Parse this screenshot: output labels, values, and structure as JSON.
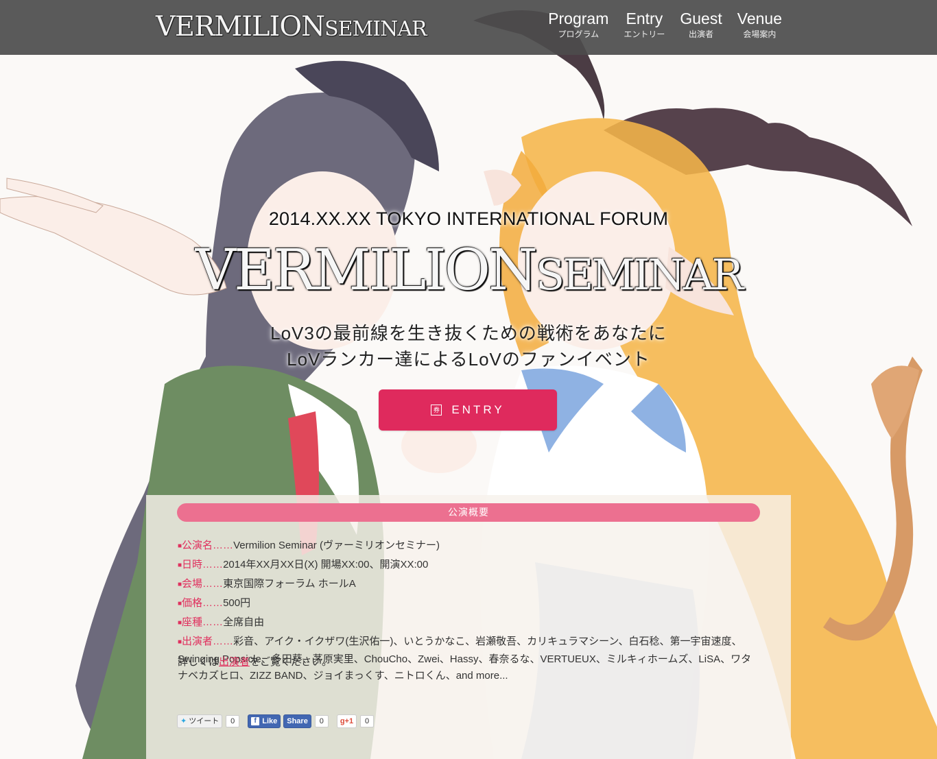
{
  "header": {
    "logo_main": "VERMILION",
    "logo_sub": "SEMINAR",
    "nav": [
      {
        "label": "Program",
        "sub": "プログラム"
      },
      {
        "label": "Entry",
        "sub": "エントリー"
      },
      {
        "label": "Guest",
        "sub": "出演者"
      },
      {
        "label": "Venue",
        "sub": "会場案内"
      }
    ]
  },
  "hero": {
    "date_line": "2014.XX.XX TOKYO INTERNATIONAL FORUM",
    "logo_main": "VERMILION",
    "logo_sub": "SEMINAR",
    "tagline1": "LoV3の最前線を生き抜くための戦術をあなたに",
    "tagline2": "LoVランカー達によるLoVのファンイベント",
    "entry_label": "ENTRY",
    "entry_icon": "ticket-icon"
  },
  "panel": {
    "heading": "公演概要",
    "rows": [
      {
        "key": "公演名……",
        "value": "Vermilion Seminar (ヴァーミリオンセミナー)"
      },
      {
        "key": "日時……",
        "value": "2014年XX月XX日(X) 開場XX:00、開演XX:00"
      },
      {
        "key": "会場……",
        "value": "東京国際フォーラム ホールA"
      },
      {
        "key": "価格……",
        "value": "500円"
      },
      {
        "key": "座種……",
        "value": "全席自由"
      }
    ],
    "performers_key": "出演者……",
    "performers_value": "彩音、アイク・イクザワ(生沢佑一)、いとうかなこ、岩瀬敬吾、カリキュラマシーン、白石稔、第一宇宙速度、Swinging Popsicle、多田葵、茅原実里、ChouCho、Zwei、Hassy、春奈るな、VERTUEUX、ミルキィホームズ、LiSA、ワタナベカズヒロ、ZIZZ BAND、ジョイまっくす、ニトロくん、and more...",
    "details_prefix": "詳しくは",
    "details_link": "出演者",
    "details_suffix": "をご覧ください。",
    "bullet": "■"
  },
  "social": {
    "tweet_label": "ツイート",
    "tweet_count": "0",
    "fb_like_label": "Like",
    "fb_share_label": "Share",
    "fb_count": "0",
    "gplus_label": "+1",
    "gplus_count": "0"
  },
  "colors": {
    "accent": "#df2a5d",
    "panel_head": "#ec7090",
    "header_bg": "#4c4c4c"
  }
}
